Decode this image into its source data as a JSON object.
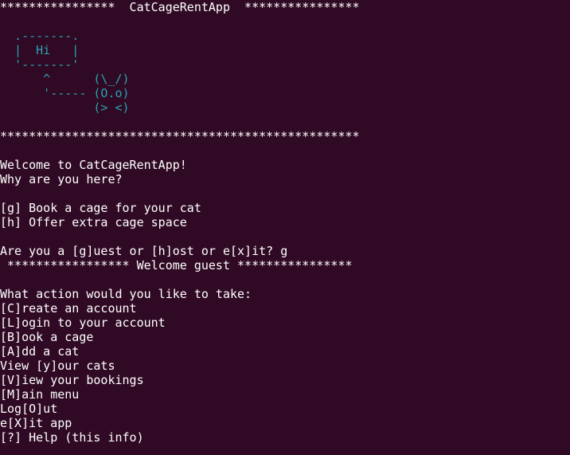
{
  "terminal": {
    "header_banner": "****************  CatCageRentApp  ****************",
    "ascii_art": [
      "  .-------.",
      "  |  Hi   |",
      "  '-------'",
      "      ^      (\\_/)",
      "      '----- (O.o)",
      "             (> <)"
    ],
    "separator": "**************************************************",
    "welcome_lines": [
      "Welcome to CatCageRentApp!",
      "Why are you here?"
    ],
    "role_options": [
      "[g] Book a cage for your cat",
      "[h] Offer extra cage space"
    ],
    "role_prompt": "Are you a [g]uest or [h]ost or e[x]it? g",
    "guest_banner": " ***************** Welcome guest ****************",
    "action_prompt": "What action would you like to take:",
    "actions": [
      "[C]reate an account",
      "[L]ogin to your account",
      "[B]ook a cage",
      "[A]dd a cat",
      "View [y]our cats",
      "[V]iew your bookings",
      "[M]ain menu",
      "Log[O]ut",
      "e[X]it app",
      "[?] Help (this info)"
    ]
  },
  "colors": {
    "background": "#300a24",
    "text": "#ffffff",
    "ascii_art": "#2aa1b3"
  }
}
